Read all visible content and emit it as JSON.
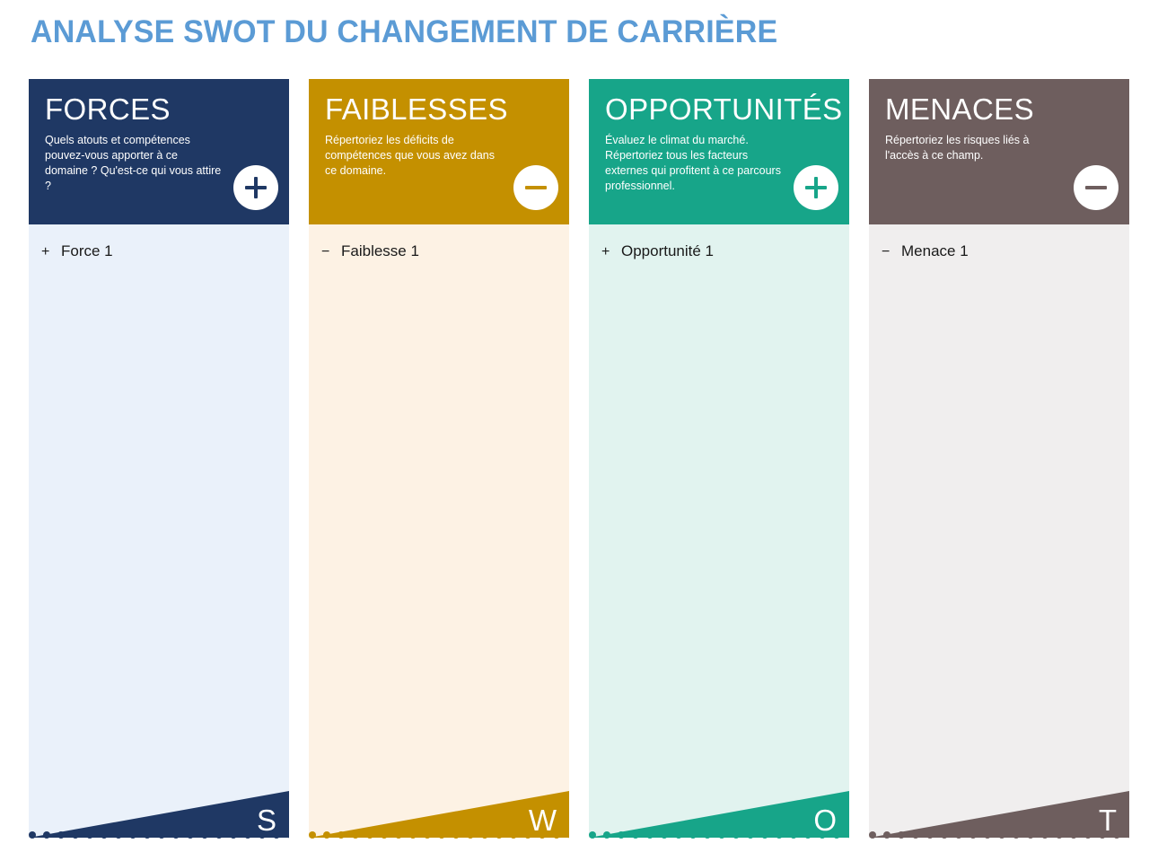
{
  "title": "ANALYSE SWOT DU CHANGEMENT DE CARRIÈRE",
  "title_color": "#5B9BD5",
  "panels": [
    {
      "key": "strengths",
      "heading": "FORCES",
      "description": "Quels atouts et compétences pouvez-vous apporter à ce domaine ? Qu'est-ce qui vous attire ?",
      "badge_icon": "plus-icon",
      "badge_sign": "+",
      "letter": "S",
      "header_color": "#1F3864",
      "body_color": "#EAF1FA",
      "dot_color": "#1F3864",
      "entries": [
        {
          "sign": "+",
          "label": "Force 1"
        }
      ]
    },
    {
      "key": "weaknesses",
      "heading": "FAIBLESSES",
      "description": "Répertoriez les déficits de compétences que vous avez dans ce domaine.",
      "badge_icon": "minus-icon",
      "badge_sign": "−",
      "letter": "W",
      "header_color": "#C49000",
      "body_color": "#FDF2E4",
      "dot_color": "#C49000",
      "entries": [
        {
          "sign": "−",
          "label": "Faiblesse 1"
        }
      ]
    },
    {
      "key": "opportunities",
      "heading": "OPPORTUNITÉS",
      "description": "Évaluez le climat du marché. Répertoriez tous les facteurs externes qui profitent à ce parcours professionnel.",
      "badge_icon": "plus-icon",
      "badge_sign": "+",
      "letter": "O",
      "header_color": "#17A589",
      "body_color": "#E1F3EF",
      "dot_color": "#17A589",
      "entries": [
        {
          "sign": "+",
          "label": "Opportunité 1"
        }
      ]
    },
    {
      "key": "threats",
      "heading": "MENACES",
      "description": "Répertoriez les risques liés à l'accès à ce champ.",
      "badge_icon": "minus-icon",
      "badge_sign": "−",
      "letter": "T",
      "header_color": "#6E5E5E",
      "body_color": "#F0EEEE",
      "dot_color": "#6E5E5E",
      "entries": [
        {
          "sign": "−",
          "label": "Menace 1"
        }
      ]
    }
  ],
  "dots_per_panel": 19
}
